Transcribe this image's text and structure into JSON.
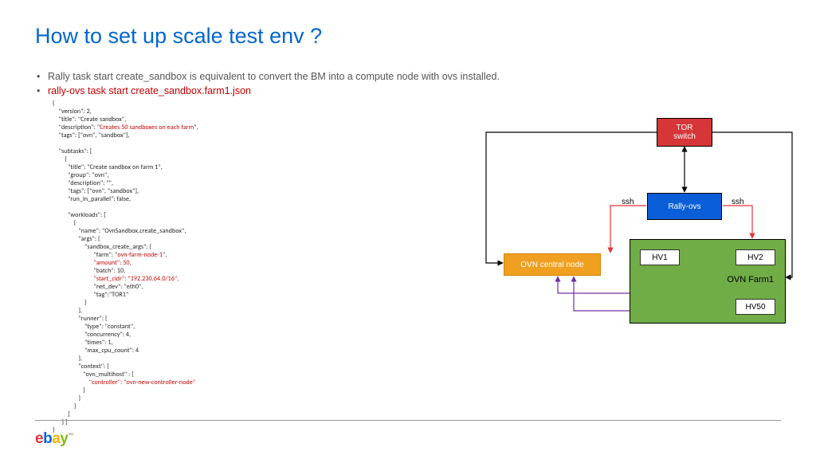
{
  "title": "How to set up scale test env ?",
  "bullets": {
    "b1": "Rally task start create_sandbox is equivalent to convert the BM into a compute node with ovs installed.",
    "b2": "rally-ovs  task start create_sandbox.farm1.json"
  },
  "code": {
    "l1": "{",
    "l2": "    \"version\": 2,",
    "l3": "    \"title\": \"Create sandbox\",",
    "l4a": "    \"description\": \"",
    "l4b": "Creates 50 sandboxes on each farm",
    "l4c": "\",",
    "l5": "    \"tags\": [\"ovn\", \"sandbox\"],",
    "l6": "",
    "l7": "    \"subtasks\": [",
    "l8": "        {",
    "l9": "          \"title\": \"Create sandbox on farm 1\",",
    "l10": "          \"group\": \"ovn\",",
    "l11": "          \"description\": \"\",",
    "l12": "          \"tags\": [\"ovn\", \"sandbox\"],",
    "l13": "          \"run_in_parallel\": false,",
    "l14": "",
    "l15": "          \"workloads\": [",
    "l16": "              {",
    "l17": "                 \"name\": \"OvnSandbox.create_sandbox\",",
    "l18": "                 \"args\": {",
    "l19": "                     \"sandbox_create_args\": {",
    "l20a": "                           \"farm\": \"",
    "l20b": "ovn-farm-node-1",
    "l20c": "\",",
    "l21": "                           \"amount\": 50,",
    "l22": "                           \"batch\": 10,",
    "l23": "                           \"start_cidr\": \"192.230.64.0/16\",",
    "l24": "                           \"net_dev\": \"eth0\",",
    "l25": "                           \"tag\":\"TOR1\"",
    "l26": "                     }",
    "l27": "                 },",
    "l28": "                 \"runner\": {",
    "l29": "                     \"type\": \"constant\",",
    "l30": "                     \"concurrency\": 4,",
    "l31": "                     \"times\": 1,",
    "l32": "                     \"max_cpu_count\": 4",
    "l33": "                 },",
    "l34": "                 \"context\": {",
    "l35": "                    \"ovn_multihost\" : {",
    "l36": "                        \"controller\": \"ovn-new-controller-node\"",
    "l37": "                    }",
    "l38": "                 }",
    "l39": "              }",
    "l40": "          ]",
    "l41": "      } ]",
    "l42": "}"
  },
  "diagram": {
    "tor": "TOR\nswitch",
    "rally": "Rally-ovs",
    "ovncn": "OVN central node",
    "farm": "OVN Farm1",
    "hv1": "HV1",
    "hv2": "HV2",
    "hv50": "HV50",
    "ssh": "ssh"
  },
  "logo": {
    "e1": "e",
    "b": "b",
    "a": "a",
    "y": "y",
    "tm": "™"
  }
}
